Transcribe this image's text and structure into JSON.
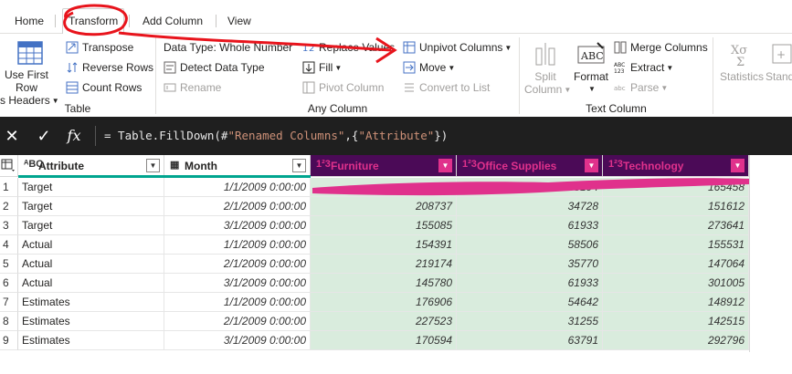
{
  "tabs": [
    {
      "label": "Home"
    },
    {
      "label": "Transform"
    },
    {
      "label": "Add Column"
    },
    {
      "label": "View"
    }
  ],
  "ribbon": {
    "table_group": {
      "label": "Table",
      "use_first_row_line1": "Use First Row",
      "use_first_row_line2": "as Headers",
      "transpose": "Transpose",
      "reverse_rows": "Reverse Rows",
      "count_rows": "Count Rows"
    },
    "any_column_group": {
      "label": "Any Column",
      "data_type": "Data Type: Whole Number",
      "detect_data_type": "Detect Data Type",
      "rename": "Rename",
      "replace_values": "Replace Values",
      "fill": "Fill",
      "pivot_column": "Pivot Column",
      "unpivot_columns": "Unpivot Columns",
      "move": "Move",
      "convert_to_list": "Convert to List"
    },
    "text_column_group": {
      "label": "Text Column",
      "split_column_line1": "Split",
      "split_column_line2": "Column",
      "format": "Format",
      "merge_columns": "Merge Columns",
      "extract": "Extract",
      "parse": "Parse"
    },
    "number_group": {
      "statistics": "Statistics",
      "standard": "Stand"
    }
  },
  "formula_bar": {
    "cancel_icon": "close-icon",
    "commit_icon": "check-icon",
    "fx_label": "fx",
    "formula_prefix": "= Table.FillDown(#",
    "formula_str1": "\"Renamed Columns\"",
    "formula_mid": ",{",
    "formula_str2": "\"Attribute\"",
    "formula_suffix": "})"
  },
  "grid": {
    "columns": [
      {
        "type": "ABC",
        "name": "Attribute",
        "selected": false
      },
      {
        "type": "cal",
        "name": "Month",
        "selected": false
      },
      {
        "type": "123",
        "name": "Furniture",
        "selected": true
      },
      {
        "type": "123",
        "name": "Office Supplies",
        "selected": true
      },
      {
        "type": "123",
        "name": "Technology",
        "selected": true
      }
    ],
    "rows": [
      {
        "n": "1",
        "attribute": "Target",
        "month": "1/1/2009 0:00:00",
        "furniture": "160824",
        "office": "55194",
        "technology": "165458"
      },
      {
        "n": "2",
        "attribute": "Target",
        "month": "2/1/2009 0:00:00",
        "furniture": "208737",
        "office": "34728",
        "technology": "151612"
      },
      {
        "n": "3",
        "attribute": "Target",
        "month": "3/1/2009 0:00:00",
        "furniture": "155085",
        "office": "61933",
        "technology": "273641"
      },
      {
        "n": "4",
        "attribute": "Actual",
        "month": "1/1/2009 0:00:00",
        "furniture": "154391",
        "office": "58506",
        "technology": "155531"
      },
      {
        "n": "5",
        "attribute": "Actual",
        "month": "2/1/2009 0:00:00",
        "furniture": "219174",
        "office": "35770",
        "technology": "147064"
      },
      {
        "n": "6",
        "attribute": "Actual",
        "month": "3/1/2009 0:00:00",
        "furniture": "145780",
        "office": "61933",
        "technology": "301005"
      },
      {
        "n": "7",
        "attribute": "Estimates",
        "month": "1/1/2009 0:00:00",
        "furniture": "176906",
        "office": "54642",
        "technology": "148912"
      },
      {
        "n": "8",
        "attribute": "Estimates",
        "month": "2/1/2009 0:00:00",
        "furniture": "227523",
        "office": "31255",
        "technology": "142515"
      },
      {
        "n": "9",
        "attribute": "Estimates",
        "month": "3/1/2009 0:00:00",
        "furniture": "170594",
        "office": "63791",
        "technology": "292796"
      }
    ]
  },
  "colors": {
    "selected_header_bg": "#4b0a57",
    "selected_header_text": "#e0318c",
    "selected_cell_bg": "#d9ecdd",
    "annotation_red": "#e8141c",
    "highlight_magenta": "#e0318c"
  }
}
